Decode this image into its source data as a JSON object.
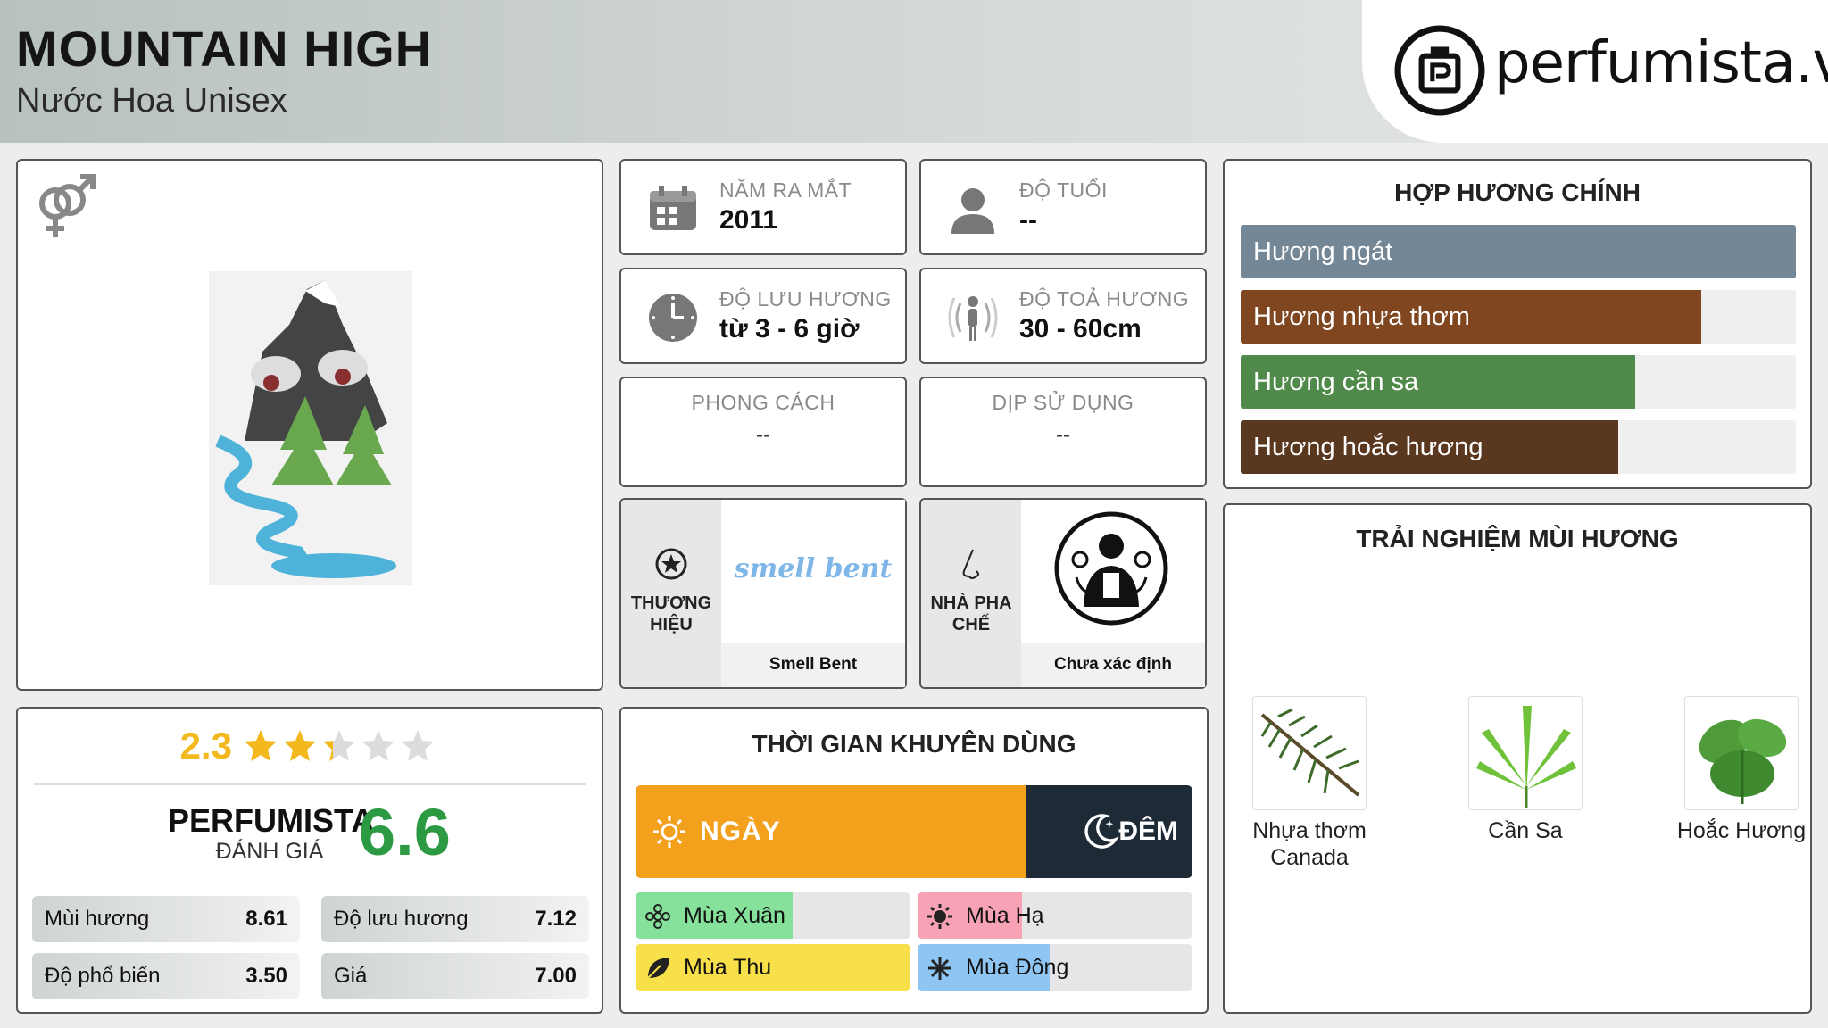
{
  "header": {
    "title": "MOUNTAIN HIGH",
    "subtitle": "Nước Hoa Unisex",
    "logo_text": "perfumista.vn"
  },
  "info": {
    "release": {
      "label": "NĂM RA MẮT",
      "value": "2011",
      "icon": "calendar-icon"
    },
    "age": {
      "label": "ĐỘ TUỔI",
      "value": "--",
      "icon": "person-icon"
    },
    "longevity": {
      "label": "ĐỘ LƯU HƯƠNG",
      "value": "từ 3 - 6 giờ",
      "icon": "clock-icon"
    },
    "sillage": {
      "label": "ĐỘ TOẢ HƯƠNG",
      "value": "30 - 60cm",
      "icon": "sillage-icon"
    },
    "style": {
      "label": "PHONG CÁCH",
      "value": "--"
    },
    "occasion": {
      "label": "DỊP SỬ DỤNG",
      "value": "--"
    }
  },
  "brand": {
    "label": "THƯƠNG HIỆU",
    "name": "Smell Bent",
    "logo_text": "smell bent"
  },
  "perfumer": {
    "label": "NHÀ PHA CHẾ",
    "name": "Chưa xác định"
  },
  "accords": {
    "title": "HỢP HƯƠNG CHÍNH",
    "items": [
      {
        "label": "Hương ngát",
        "percent": 100,
        "color": "#748796"
      },
      {
        "label": "Hương nhựa thơm",
        "percent": 83,
        "color": "#7f4620"
      },
      {
        "label": "Hương cần sa",
        "percent": 71,
        "color": "#4f8a4a"
      },
      {
        "label": "Hương hoắc hương",
        "percent": 68,
        "color": "#5a3820"
      }
    ]
  },
  "experience": {
    "title": "TRẢI NGHIỆM MÙI HƯƠNG",
    "notes": [
      {
        "label": "Nhựa thơm Canada",
        "icon": "fir-branch-icon"
      },
      {
        "label": "Cần Sa",
        "icon": "cannabis-leaf-icon"
      },
      {
        "label": "Hoắc Hương",
        "icon": "patchouli-leaf-icon"
      }
    ]
  },
  "rating": {
    "value": "2.3",
    "stars": 2.3,
    "pf_label": "PERFUMISTA",
    "pf_sub": "ĐÁNH GIÁ",
    "pf_score": "6.6",
    "scores": [
      {
        "label": "Mùi hương",
        "value": "8.61"
      },
      {
        "label": "Độ lưu hương",
        "value": "7.12"
      },
      {
        "label": "Độ phổ biến",
        "value": "3.50"
      },
      {
        "label": "Giá",
        "value": "7.00"
      }
    ]
  },
  "time": {
    "title": "THỜI GIAN KHUYÊN DÙNG",
    "day_label": "NGÀY",
    "night_label": "ĐÊM",
    "day_percent": 70,
    "seasons": [
      {
        "label": "Mùa Xuân",
        "percent": 57,
        "color": "#86e29b",
        "icon": "flower-icon"
      },
      {
        "label": "Mùa Hạ",
        "percent": 38,
        "color": "#f8a3b5",
        "icon": "sun-icon"
      },
      {
        "label": "Mùa Thu",
        "percent": 100,
        "color": "#f8e04a",
        "icon": "leaf-icon"
      },
      {
        "label": "Mùa Đông",
        "percent": 48,
        "color": "#8fc5f2",
        "icon": "snowflake-icon"
      }
    ]
  }
}
